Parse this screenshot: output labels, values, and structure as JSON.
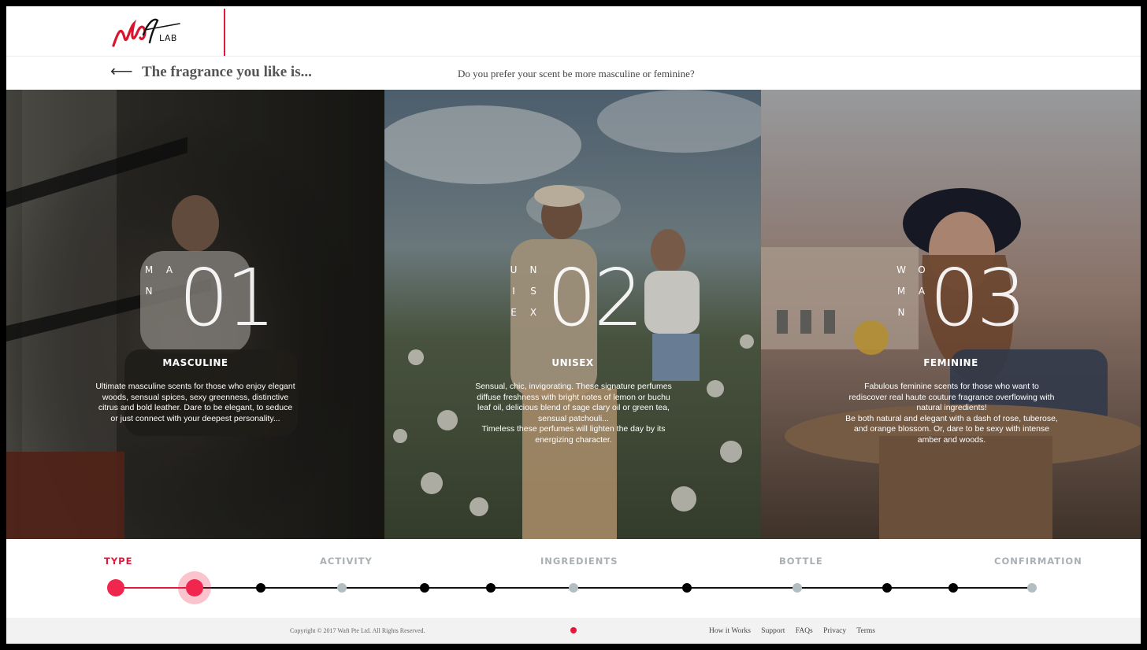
{
  "header": {
    "logo_text": "LAB",
    "back_icon": "arrow-left-icon",
    "title": "The fragrance you like is...",
    "question": "Do you prefer your scent be more masculine or feminine?"
  },
  "options": [
    {
      "number": "01",
      "vertical": [
        "M",
        "A",
        "N"
      ],
      "title": "MASCULINE",
      "description": [
        "Ultimate masculine scents for those who enjoy elegant woods, sensual spices, sexy greenness, distinctive citrus and bold leather. Dare to be elegant, to seduce or just connect with your deepest personality..."
      ]
    },
    {
      "number": "02",
      "vertical": [
        "U",
        "N",
        "I",
        "S",
        "E",
        "X"
      ],
      "title": "UNISEX",
      "description": [
        "Sensual, chic, invigorating. These signature perfumes diffuse freshness with bright notes of lemon or buchu leaf oil, delicious blend of sage clary oil or green tea, sensual patchouli...",
        "Timeless these perfumes will lighten the day by its energizing character."
      ]
    },
    {
      "number": "03",
      "vertical": [
        "W",
        "O",
        "M",
        "A",
        "N"
      ],
      "title": "FEMININE",
      "description": [
        "Fabulous feminine scents for those who want to rediscover real haute couture fragrance overflowing with natural ingredients!",
        "Be both natural and elegant with a dash of rose, tuberose, and orange blossom. Or, dare to be sexy with intense amber and woods."
      ]
    }
  ],
  "steps": [
    {
      "label": "TYPE",
      "active": true
    },
    {
      "label": "ACTIVITY",
      "active": false
    },
    {
      "label": "INGREDIENTS",
      "active": false
    },
    {
      "label": "BOTTLE",
      "active": false
    },
    {
      "label": "CONFIRMATION",
      "active": false
    }
  ],
  "progress": {
    "completed_fraction": 0.09
  },
  "footer": {
    "copyright": "Copyright © 2017 Waft Pte Ltd. All Rights Reserved.",
    "links": [
      "How it Works",
      "Support",
      "FAQs",
      "Privacy",
      "Terms"
    ]
  },
  "colors": {
    "accent": "#e3173a",
    "inactive": "#a9b0b4"
  }
}
